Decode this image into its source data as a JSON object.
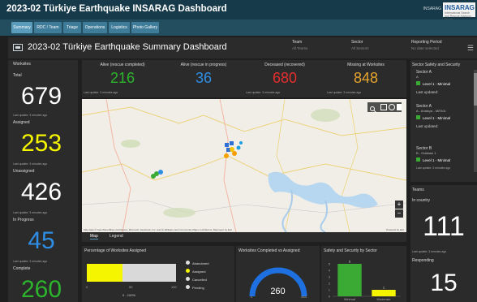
{
  "app": {
    "title": "2023-02 Türkiye Earthquake INSARAG Dashboard",
    "brand_small": "INSARAG",
    "logo_text": "INSARAG",
    "logo_sub": "International Search and Rescue Advisory Group"
  },
  "nav": {
    "tabs": [
      {
        "label": "Summary"
      },
      {
        "label": "RDC / Team"
      },
      {
        "label": "Triage"
      },
      {
        "label": "Operations"
      },
      {
        "label": "Logistics"
      },
      {
        "label": "Photo Gallery"
      }
    ]
  },
  "header": {
    "title": "2023-02 Türkiye Earthquake Summary Dashboard",
    "team_label": "Team",
    "team_value": "All Teams",
    "sector_label": "Sector",
    "sector_value": "All Sectors",
    "period_label": "Reporting Period",
    "period_value": "No date selected"
  },
  "worksites": {
    "title": "Worksites",
    "total_label": "Total",
    "total": "679",
    "assigned_label": "Assigned",
    "assigned": "253",
    "unassigned_label": "Unassigned",
    "unassigned": "426",
    "inprogress_label": "In Progress",
    "inprogress": "45",
    "complete_label": "Complete",
    "complete": "260",
    "updated": "Last update: 3 minutes ago"
  },
  "kpis": [
    {
      "label": "Alive (rescue completed)",
      "value": "216",
      "color": "#2db42d"
    },
    {
      "label": "Alive (rescue in progress)",
      "value": "36",
      "color": "#2e8ee6"
    },
    {
      "label": "Deceased (recovered)",
      "value": "680",
      "color": "#e62e2e"
    },
    {
      "label": "Missing at Worksites",
      "value": "848",
      "color": "#e6a52e"
    }
  ],
  "kpi_updated": "Last update: 3 minutes ago",
  "map": {
    "attribution": "Map data © OpenStreetMap contributors, Microsoft, Facebook, Inc. and its affiliates, Esri Community Maps contributors, Map layer by Esri",
    "powered": "Powered by Esri",
    "tab_map": "Map",
    "tab_legend": "Legend"
  },
  "safety": {
    "title": "Sector Safety and Security",
    "items": [
      {
        "sector": "Sector A",
        "name": "A",
        "level": "Level 1 - Minimal",
        "updated": "Last updated:"
      },
      {
        "sector": "Sector A",
        "name": "A - Antakya - MES01",
        "level": "Level 1 - Minimal",
        "updated": "Last updated:"
      },
      {
        "sector": "Sector B",
        "name": "B - Odabasi 1",
        "level": "Level 1 - Minimal",
        "updated": "Last update: 3 minutes ago"
      }
    ]
  },
  "teams": {
    "title": "Teams",
    "incountry_label": "In country",
    "incountry": "111",
    "updated": "Last update: 3 minutes ago",
    "responding_label": "Responding",
    "responding": "15"
  },
  "pct_assigned": {
    "title": "Percentage of Worksites Assigned",
    "ticks": [
      "0",
      "50",
      "100"
    ],
    "caption": "0 - 100%",
    "value": 40,
    "legend": [
      {
        "label": "Abandoned",
        "color": "#e0e0e0"
      },
      {
        "label": "Assigned",
        "color": "#f5f500"
      },
      {
        "label": "Cancelled",
        "color": "#e0e0e0"
      },
      {
        "label": "Pending",
        "color": "#e0e0e0"
      }
    ]
  },
  "completed": {
    "title": "Worksites Completed vs Assigned",
    "value": "260",
    "min": "0",
    "max": "253"
  },
  "safety_chart": {
    "title": "Safety and Security by Sector",
    "chart_data": {
      "type": "bar",
      "categories": [
        "Minimal",
        "Moderate"
      ],
      "values": [
        5,
        1
      ],
      "colors": [
        "#3aaa35",
        "#f5f500"
      ],
      "ylim": [
        0,
        5
      ],
      "yticks": [
        "0",
        "1",
        "2",
        "3",
        "4",
        "5"
      ]
    }
  }
}
